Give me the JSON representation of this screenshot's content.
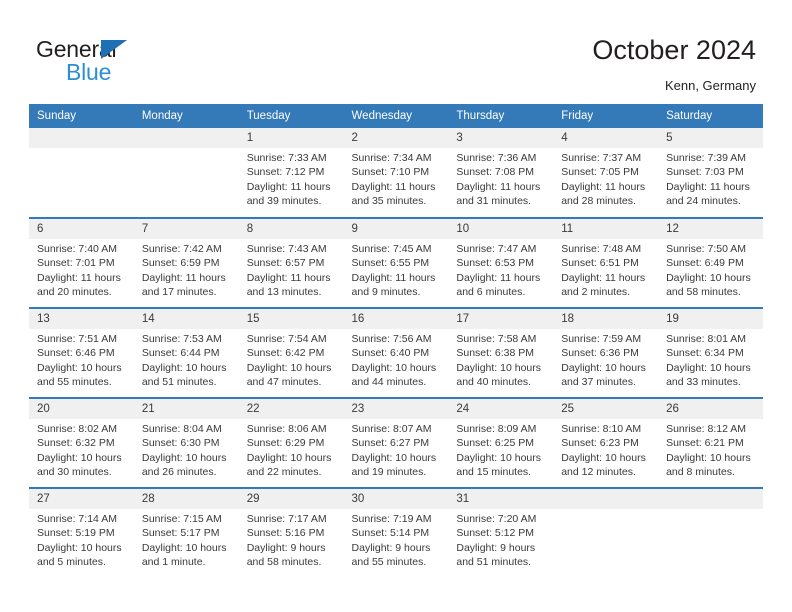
{
  "brand": {
    "name_top": "General",
    "name_bottom": "Blue",
    "color_dark": "#231f20",
    "color_blue": "#2b8fd6",
    "triangle_color": "#1f6fb5"
  },
  "header": {
    "title": "October 2024",
    "location": "Kenn, Germany"
  },
  "theme": {
    "header_bg": "#3479b8",
    "daynum_bg": "#f0f0f0",
    "text": "#3a3a3a"
  },
  "weekday_headers": [
    "Sunday",
    "Monday",
    "Tuesday",
    "Wednesday",
    "Thursday",
    "Friday",
    "Saturday"
  ],
  "weeks": [
    [
      {
        "day": "",
        "info": "",
        "blank": true
      },
      {
        "day": "",
        "info": "",
        "blank": true
      },
      {
        "day": "1",
        "info": "Sunrise: 7:33 AM\nSunset: 7:12 PM\nDaylight: 11 hours and 39 minutes."
      },
      {
        "day": "2",
        "info": "Sunrise: 7:34 AM\nSunset: 7:10 PM\nDaylight: 11 hours and 35 minutes."
      },
      {
        "day": "3",
        "info": "Sunrise: 7:36 AM\nSunset: 7:08 PM\nDaylight: 11 hours and 31 minutes."
      },
      {
        "day": "4",
        "info": "Sunrise: 7:37 AM\nSunset: 7:05 PM\nDaylight: 11 hours and 28 minutes."
      },
      {
        "day": "5",
        "info": "Sunrise: 7:39 AM\nSunset: 7:03 PM\nDaylight: 11 hours and 24 minutes."
      }
    ],
    [
      {
        "day": "6",
        "info": "Sunrise: 7:40 AM\nSunset: 7:01 PM\nDaylight: 11 hours and 20 minutes."
      },
      {
        "day": "7",
        "info": "Sunrise: 7:42 AM\nSunset: 6:59 PM\nDaylight: 11 hours and 17 minutes."
      },
      {
        "day": "8",
        "info": "Sunrise: 7:43 AM\nSunset: 6:57 PM\nDaylight: 11 hours and 13 minutes."
      },
      {
        "day": "9",
        "info": "Sunrise: 7:45 AM\nSunset: 6:55 PM\nDaylight: 11 hours and 9 minutes."
      },
      {
        "day": "10",
        "info": "Sunrise: 7:47 AM\nSunset: 6:53 PM\nDaylight: 11 hours and 6 minutes."
      },
      {
        "day": "11",
        "info": "Sunrise: 7:48 AM\nSunset: 6:51 PM\nDaylight: 11 hours and 2 minutes."
      },
      {
        "day": "12",
        "info": "Sunrise: 7:50 AM\nSunset: 6:49 PM\nDaylight: 10 hours and 58 minutes."
      }
    ],
    [
      {
        "day": "13",
        "info": "Sunrise: 7:51 AM\nSunset: 6:46 PM\nDaylight: 10 hours and 55 minutes."
      },
      {
        "day": "14",
        "info": "Sunrise: 7:53 AM\nSunset: 6:44 PM\nDaylight: 10 hours and 51 minutes."
      },
      {
        "day": "15",
        "info": "Sunrise: 7:54 AM\nSunset: 6:42 PM\nDaylight: 10 hours and 47 minutes."
      },
      {
        "day": "16",
        "info": "Sunrise: 7:56 AM\nSunset: 6:40 PM\nDaylight: 10 hours and 44 minutes."
      },
      {
        "day": "17",
        "info": "Sunrise: 7:58 AM\nSunset: 6:38 PM\nDaylight: 10 hours and 40 minutes."
      },
      {
        "day": "18",
        "info": "Sunrise: 7:59 AM\nSunset: 6:36 PM\nDaylight: 10 hours and 37 minutes."
      },
      {
        "day": "19",
        "info": "Sunrise: 8:01 AM\nSunset: 6:34 PM\nDaylight: 10 hours and 33 minutes."
      }
    ],
    [
      {
        "day": "20",
        "info": "Sunrise: 8:02 AM\nSunset: 6:32 PM\nDaylight: 10 hours and 30 minutes."
      },
      {
        "day": "21",
        "info": "Sunrise: 8:04 AM\nSunset: 6:30 PM\nDaylight: 10 hours and 26 minutes."
      },
      {
        "day": "22",
        "info": "Sunrise: 8:06 AM\nSunset: 6:29 PM\nDaylight: 10 hours and 22 minutes."
      },
      {
        "day": "23",
        "info": "Sunrise: 8:07 AM\nSunset: 6:27 PM\nDaylight: 10 hours and 19 minutes."
      },
      {
        "day": "24",
        "info": "Sunrise: 8:09 AM\nSunset: 6:25 PM\nDaylight: 10 hours and 15 minutes."
      },
      {
        "day": "25",
        "info": "Sunrise: 8:10 AM\nSunset: 6:23 PM\nDaylight: 10 hours and 12 minutes."
      },
      {
        "day": "26",
        "info": "Sunrise: 8:12 AM\nSunset: 6:21 PM\nDaylight: 10 hours and 8 minutes."
      }
    ],
    [
      {
        "day": "27",
        "info": "Sunrise: 7:14 AM\nSunset: 5:19 PM\nDaylight: 10 hours and 5 minutes."
      },
      {
        "day": "28",
        "info": "Sunrise: 7:15 AM\nSunset: 5:17 PM\nDaylight: 10 hours and 1 minute."
      },
      {
        "day": "29",
        "info": "Sunrise: 7:17 AM\nSunset: 5:16 PM\nDaylight: 9 hours and 58 minutes."
      },
      {
        "day": "30",
        "info": "Sunrise: 7:19 AM\nSunset: 5:14 PM\nDaylight: 9 hours and 55 minutes."
      },
      {
        "day": "31",
        "info": "Sunrise: 7:20 AM\nSunset: 5:12 PM\nDaylight: 9 hours and 51 minutes."
      },
      {
        "day": "",
        "info": "",
        "blank": true
      },
      {
        "day": "",
        "info": "",
        "blank": true
      }
    ]
  ]
}
